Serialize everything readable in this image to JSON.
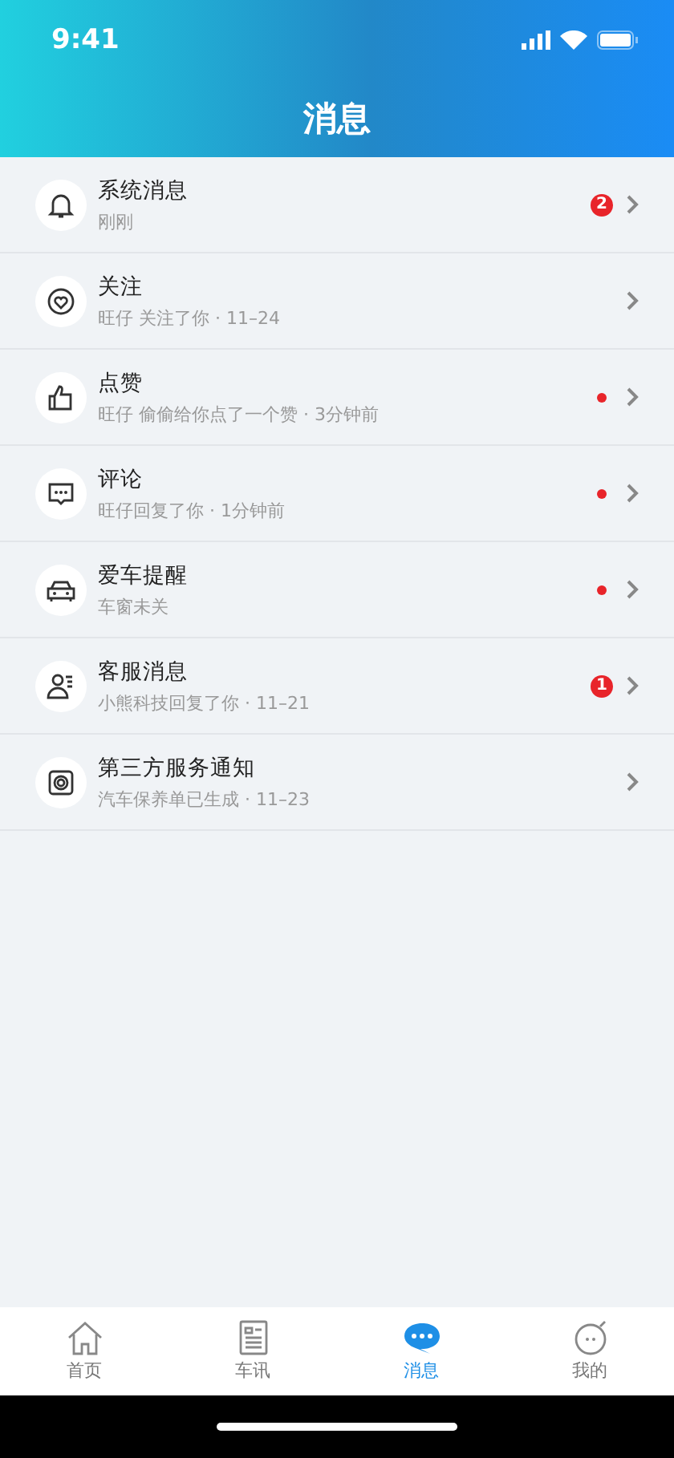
{
  "status_bar": {
    "time": "9:41"
  },
  "header": {
    "title": "消息"
  },
  "messages": [
    {
      "title": "系统消息",
      "subtitle": "刚刚",
      "badge": {
        "kind": "count",
        "text": "2"
      }
    },
    {
      "title": "关注",
      "subtitle": "旺仔 关注了你 · 11–24"
    },
    {
      "title": "点赞",
      "subtitle": "旺仔 偷偷给你点了一个赞 · 3分钟前",
      "badge": {
        "kind": "dot"
      }
    },
    {
      "title": "评论",
      "subtitle": "旺仔回复了你 · 1分钟前",
      "badge": {
        "kind": "dot"
      }
    },
    {
      "title": "爱车提醒",
      "subtitle": "车窗未关",
      "badge": {
        "kind": "dot"
      }
    },
    {
      "title": "客服消息",
      "subtitle": "小熊科技回复了你 · 11–21",
      "badge": {
        "kind": "count",
        "text": "1"
      }
    },
    {
      "title": "第三方服务通知",
      "subtitle": "汽车保养单已生成 · 11–23"
    }
  ],
  "tab_bar": [
    {
      "label": "首页",
      "selected": false
    },
    {
      "label": "车讯",
      "selected": false
    },
    {
      "label": "消息",
      "selected": true
    },
    {
      "label": "我的",
      "selected": false
    }
  ]
}
